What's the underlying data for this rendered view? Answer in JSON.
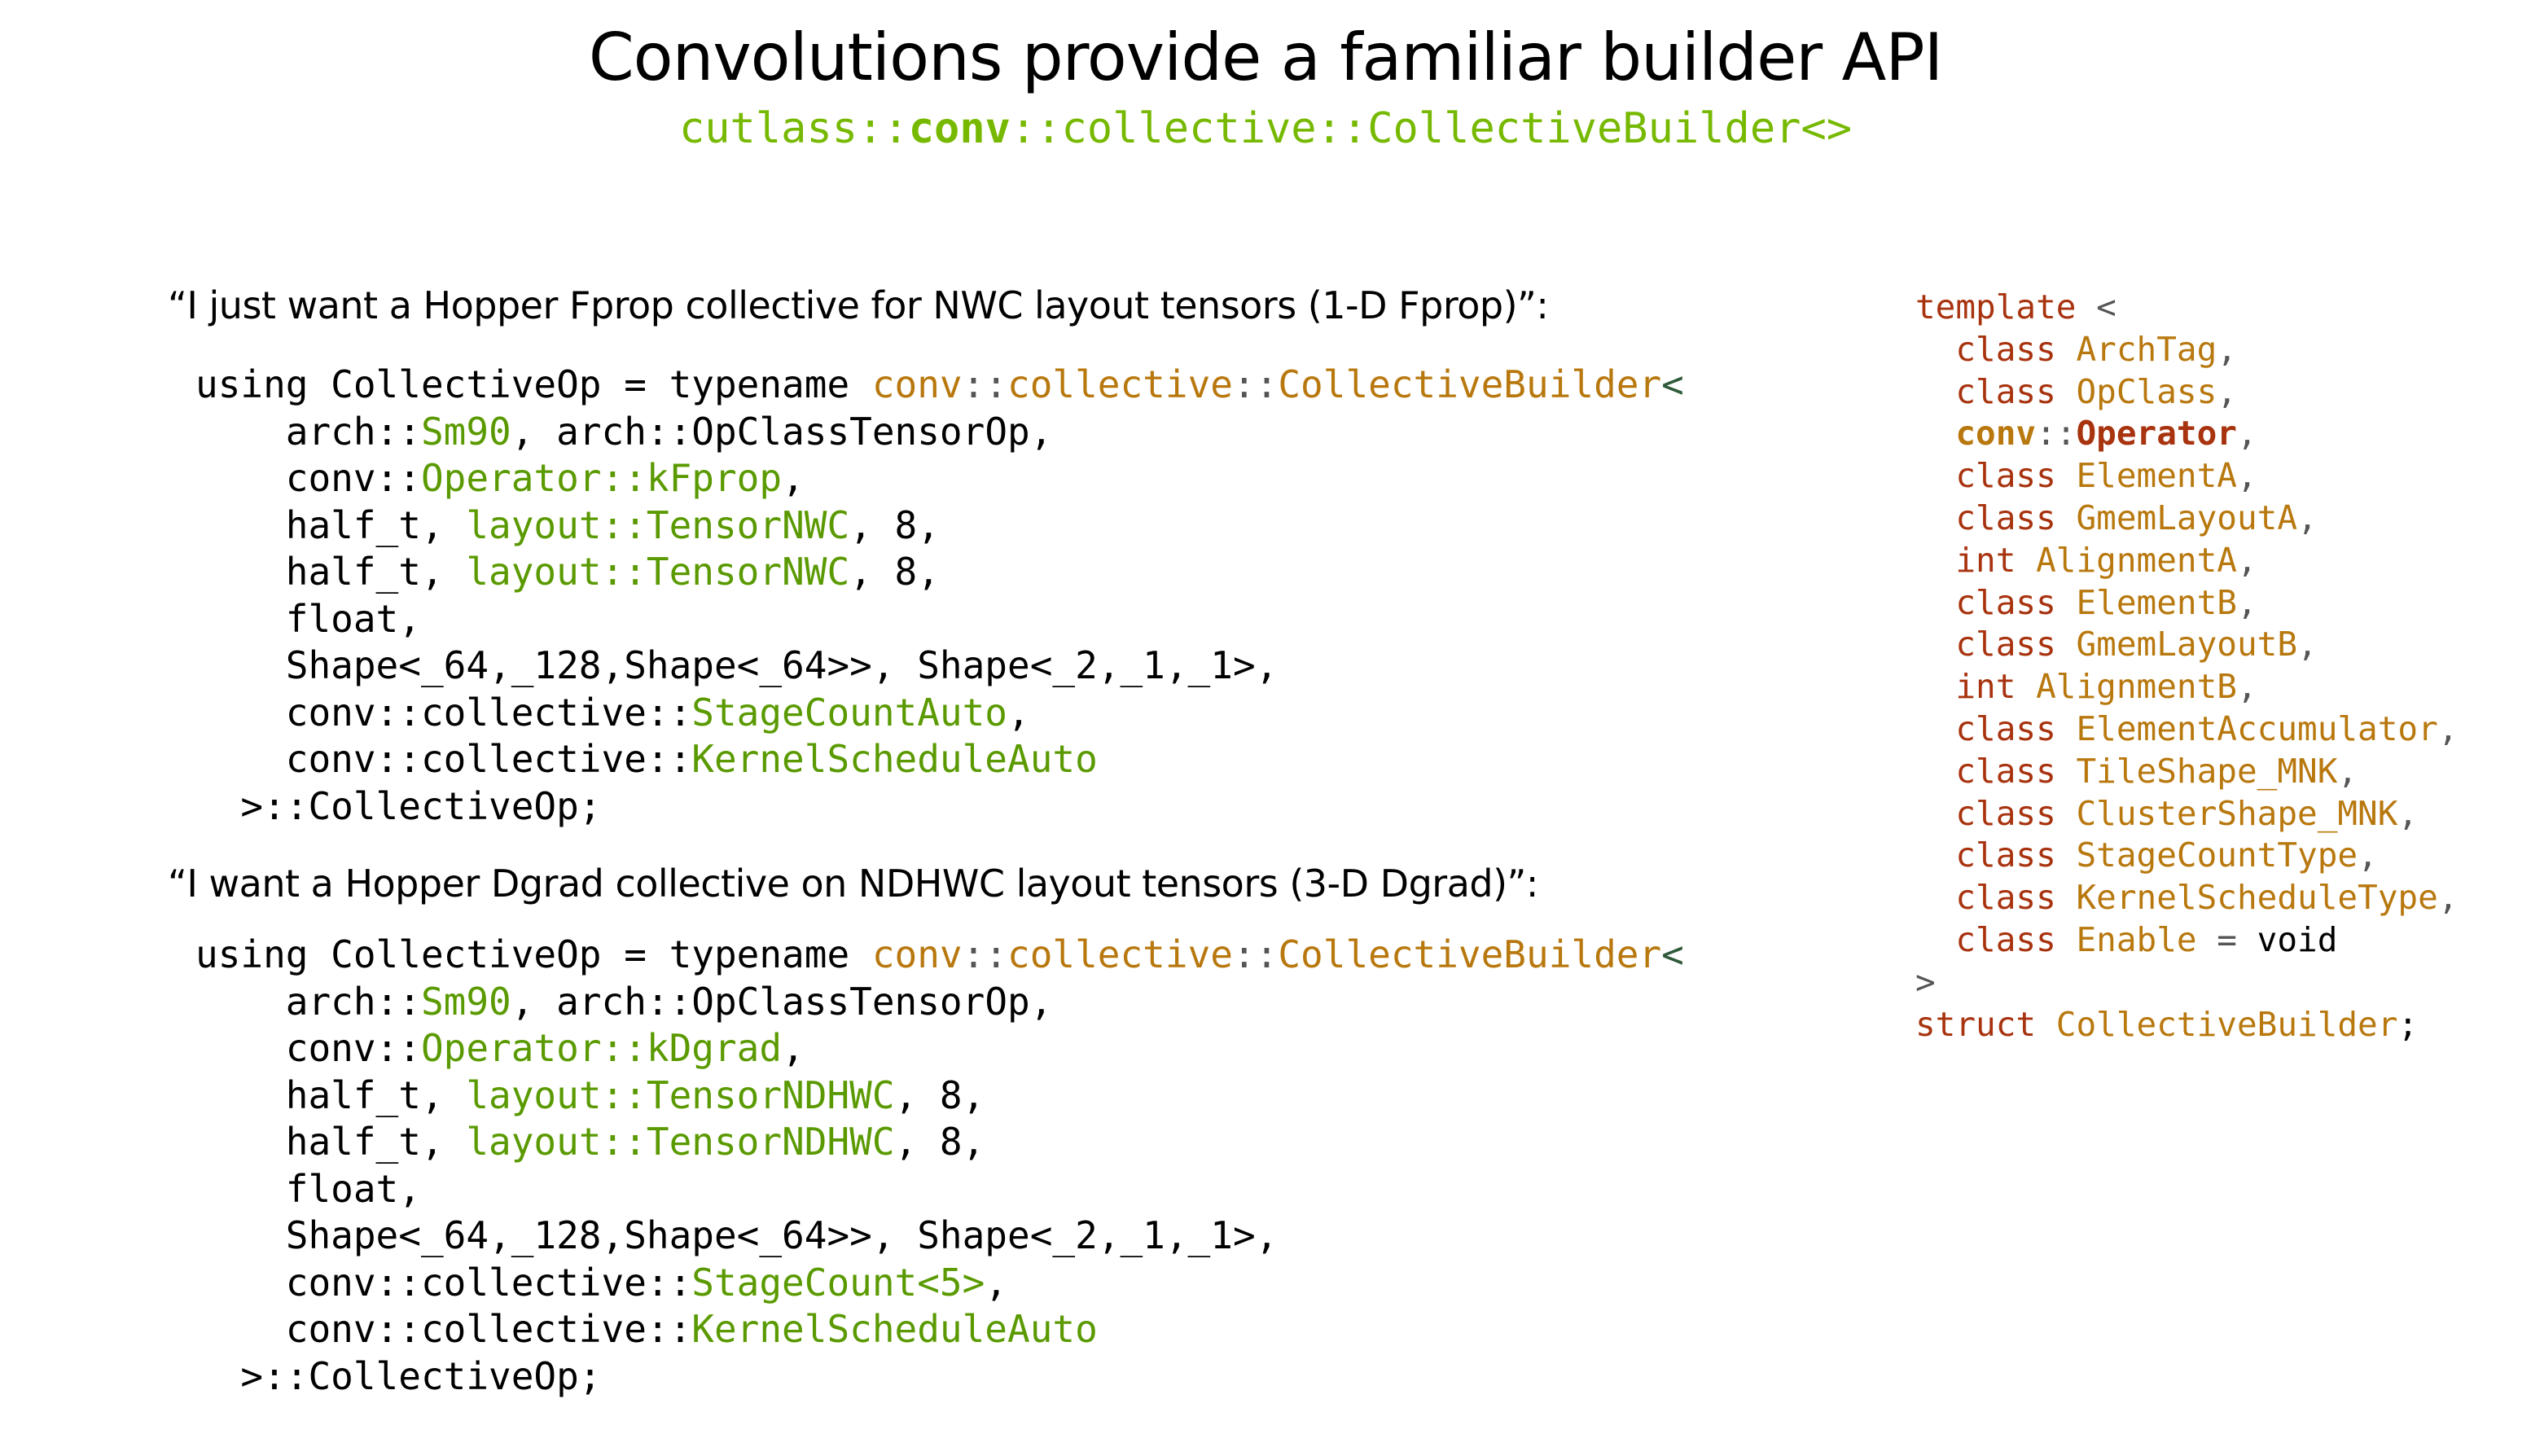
{
  "title": "Convolutions provide a familiar builder API",
  "subtitle": {
    "prefix": "cutlass::",
    "bold": "conv",
    "suffix": "::collective::CollectiveBuilder<>"
  },
  "sections": [
    {
      "heading": "“I just want a Hopper Fprop collective for NWC layout tensors (1-D Fprop)”:",
      "code": {
        "l1_a": "using CollectiveOp = typename ",
        "l1_b": "conv",
        "l1_c": "::",
        "l1_d": "collective",
        "l1_e": "::",
        "l1_f": "CollectiveBuilder",
        "l1_g": "<",
        "l2_a": "    arch::",
        "l2_b": "Sm90",
        "l2_c": ", arch::OpClassTensorOp,",
        "l3_a": "    conv::",
        "l3_b": "Operator::kFprop",
        "l3_c": ",",
        "l4_a": "    half_t, ",
        "l4_b": "layout::TensorNWC",
        "l4_c": ", 8,",
        "l5_a": "    half_t, ",
        "l5_b": "layout::TensorNWC",
        "l5_c": ", 8,",
        "l6": "    float,",
        "l7": "    Shape<_64,_128,Shape<_64>>, Shape<_2,_1,_1>,",
        "l8_a": "    conv::collective::",
        "l8_b": "StageCountAuto",
        "l8_c": ",",
        "l9_a": "    conv::collective::",
        "l9_b": "KernelScheduleAuto",
        "l10": "  >::CollectiveOp;"
      }
    },
    {
      "heading": "“I want a Hopper Dgrad collective on NDHWC layout tensors (3-D Dgrad)”:",
      "code": {
        "l1_a": "using CollectiveOp = typename ",
        "l1_b": "conv",
        "l1_c": "::",
        "l1_d": "collective",
        "l1_e": "::",
        "l1_f": "CollectiveBuilder",
        "l1_g": "<",
        "l2_a": "    arch::",
        "l2_b": "Sm90",
        "l2_c": ", arch::OpClassTensorOp,",
        "l3_a": "    conv::",
        "l3_b": "Operator::kDgrad",
        "l3_c": ",",
        "l4_a": "    half_t, ",
        "l4_b": "layout::TensorNDHWC",
        "l4_c": ", 8,",
        "l5_a": "    half_t, ",
        "l5_b": "layout::TensorNDHWC",
        "l5_c": ", 8,",
        "l6": "    float,",
        "l7": "    Shape<_64,_128,Shape<_64>>, Shape<_2,_1,_1>,",
        "l8_a": "    conv::collective::",
        "l8_b": "StageCount<5>",
        "l8_c": ",",
        "l9_a": "    conv::collective::",
        "l9_b": "KernelScheduleAuto",
        "l10": "  >::CollectiveOp;"
      }
    }
  ],
  "signature": {
    "template_kw": "template",
    "open": " <",
    "params": [
      {
        "kw": "class",
        "name": "ArchTag",
        "sep": ","
      },
      {
        "kw": "class",
        "name": "OpClass",
        "sep": ","
      },
      {
        "kw": "conv",
        "name": "Operator",
        "sep": ",",
        "bold": true
      },
      {
        "kw": "class",
        "name": "ElementA",
        "sep": ","
      },
      {
        "kw": "class",
        "name": "GmemLayoutA",
        "sep": ","
      },
      {
        "kw": "int",
        "name": "AlignmentA",
        "sep": ","
      },
      {
        "kw": "class",
        "name": "ElementB",
        "sep": ","
      },
      {
        "kw": "class",
        "name": "GmemLayoutB",
        "sep": ","
      },
      {
        "kw": "int",
        "name": "AlignmentB",
        "sep": ","
      },
      {
        "kw": "class",
        "name": "ElementAccumulator",
        "sep": ","
      },
      {
        "kw": "class",
        "name": "TileShape_MNK",
        "sep": ","
      },
      {
        "kw": "class",
        "name": "ClusterShape_MNK",
        "sep": ","
      },
      {
        "kw": "class",
        "name": "StageCountType",
        "sep": ","
      },
      {
        "kw": "class",
        "name": "KernelScheduleType",
        "sep": ","
      }
    ],
    "enable_kw": "class",
    "enable_name": "Enable",
    "enable_eq": " = ",
    "enable_val": "void",
    "close": ">",
    "struct_kw": "struct",
    "struct_name": "CollectiveBuilder",
    "struct_end": ";"
  },
  "colors": {
    "nvidia_green": "#76b900",
    "orange": "#b8780e",
    "keyword_red": "#a8330f",
    "green": "#5a9a00"
  }
}
